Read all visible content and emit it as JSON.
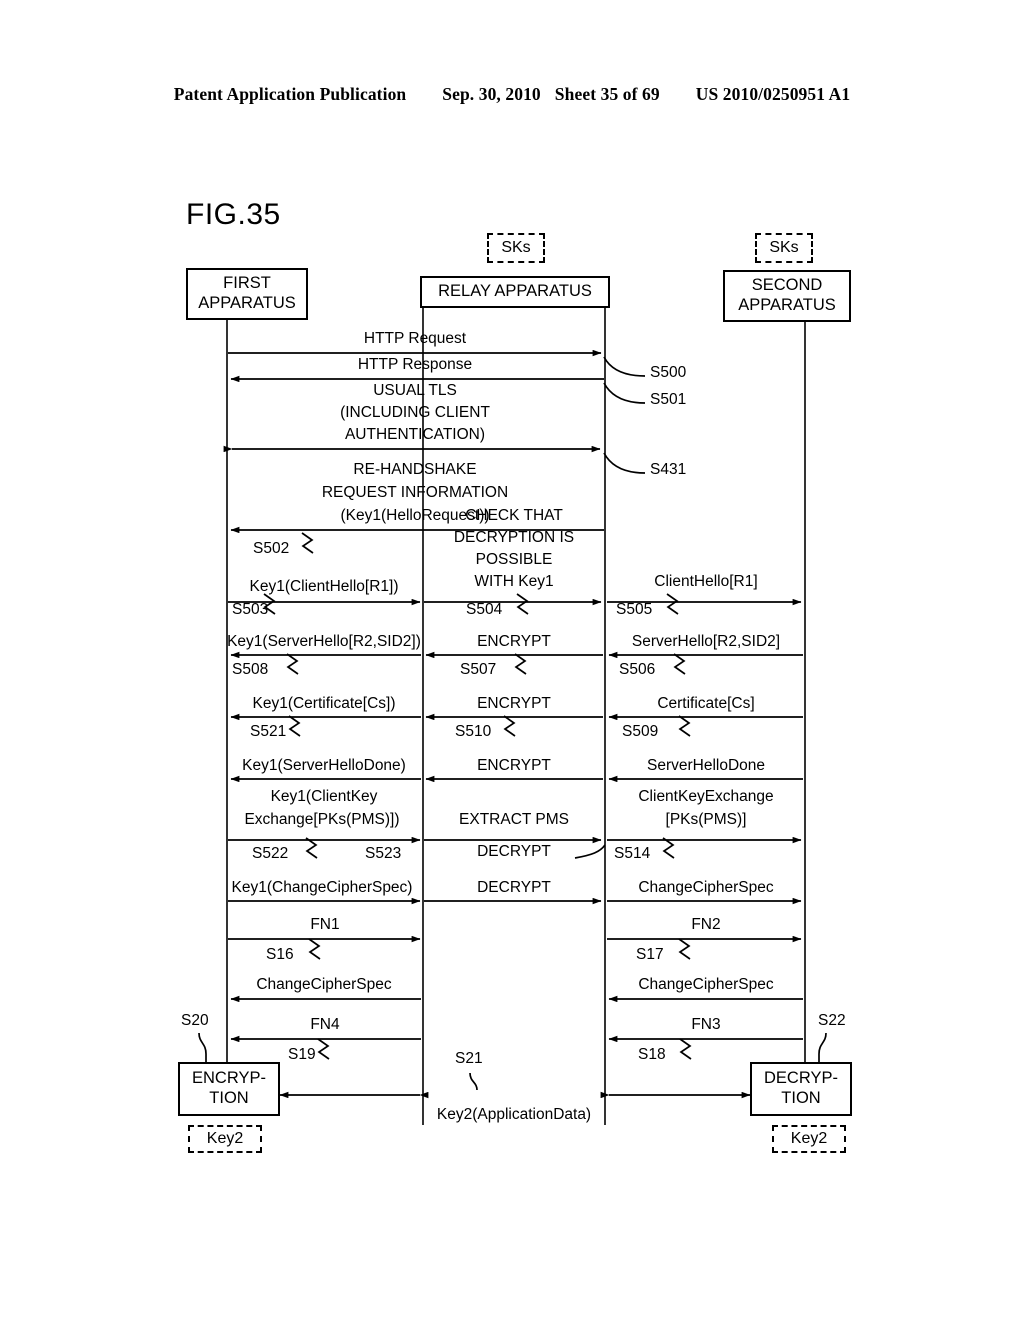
{
  "header": {
    "publication": "Patent Application Publication",
    "date": "Sep. 30, 2010",
    "sheet": "Sheet 35 of 69",
    "patent_number": "US 2010/0250951 A1"
  },
  "figure": {
    "label": "FIG.35",
    "nodes": {
      "first_apparatus": "FIRST\nAPPARATUS",
      "first_apparatus_l1": "FIRST",
      "first_apparatus_l2": "APPARATUS",
      "relay_apparatus": "RELAY APPARATUS",
      "second_apparatus_l1": "SECOND",
      "second_apparatus_l2": "APPARATUS",
      "encryption_l1": "ENCRYP-",
      "encryption_l2": "TION",
      "decryption_l1": "DECRYP-",
      "decryption_l2": "TION"
    },
    "keys": {
      "relay_sks": "SKs",
      "second_sks": "SKs",
      "encryption_key2": "Key2",
      "decryption_key2": "Key2"
    },
    "messages": [
      {
        "id": "m-http-request",
        "text": "HTTP Request"
      },
      {
        "id": "m-http-response",
        "text": "HTTP Response"
      },
      {
        "id": "m-usual-tls-1",
        "text": "USUAL TLS"
      },
      {
        "id": "m-usual-tls-2",
        "text": "(INCLUDING CLIENT"
      },
      {
        "id": "m-usual-tls-3",
        "text": "AUTHENTICATION)"
      },
      {
        "id": "m-rehandshake-1",
        "text": "RE-HANDSHAKE"
      },
      {
        "id": "m-rehandshake-2",
        "text": "REQUEST INFORMATION"
      },
      {
        "id": "m-rehandshake-3",
        "text": "(Key1(HelloRequest))"
      },
      {
        "id": "m-check-1",
        "text": "CHECK THAT"
      },
      {
        "id": "m-check-2",
        "text": "DECRYPTION IS"
      },
      {
        "id": "m-check-3",
        "text": "POSSIBLE"
      },
      {
        "id": "m-check-4",
        "text": "WITH Key1"
      },
      {
        "id": "m-key1-clienthello",
        "text": "Key1(ClientHello[R1])"
      },
      {
        "id": "m-clienthello",
        "text": "ClientHello[R1]"
      },
      {
        "id": "m-key1-serverhello",
        "text": "Key1(ServerHello[R2,SID2])"
      },
      {
        "id": "m-encrypt-1",
        "text": "ENCRYPT"
      },
      {
        "id": "m-serverhello",
        "text": "ServerHello[R2,SID2]"
      },
      {
        "id": "m-key1-certificate",
        "text": "Key1(Certificate[Cs])"
      },
      {
        "id": "m-encrypt-2",
        "text": "ENCRYPT"
      },
      {
        "id": "m-certificate",
        "text": "Certificate[Cs]"
      },
      {
        "id": "m-key1-serverhellodone",
        "text": "Key1(ServerHelloDone)"
      },
      {
        "id": "m-encrypt-3",
        "text": "ENCRYPT"
      },
      {
        "id": "m-serverhellodone",
        "text": "ServerHelloDone"
      },
      {
        "id": "m-key1-clientkey-1",
        "text": "Key1(ClientKey"
      },
      {
        "id": "m-key1-clientkey-2",
        "text": "Exchange[PKs(PMS)])"
      },
      {
        "id": "m-extract-pms",
        "text": "EXTRACT PMS"
      },
      {
        "id": "m-clientkeyexchange-1",
        "text": "ClientKeyExchange"
      },
      {
        "id": "m-clientkeyexchange-2",
        "text": "[PKs(PMS)]"
      },
      {
        "id": "m-decrypt-1",
        "text": "DECRYPT"
      },
      {
        "id": "m-key1-changecipherspec",
        "text": "Key1(ChangeCipherSpec)"
      },
      {
        "id": "m-decrypt-2",
        "text": "DECRYPT"
      },
      {
        "id": "m-changecipherspec-r",
        "text": "ChangeCipherSpec"
      },
      {
        "id": "m-fn1",
        "text": "FN1"
      },
      {
        "id": "m-fn2",
        "text": "FN2"
      },
      {
        "id": "m-changecipherspec-back-l",
        "text": "ChangeCipherSpec"
      },
      {
        "id": "m-changecipherspec-back-r",
        "text": "ChangeCipherSpec"
      },
      {
        "id": "m-fn4",
        "text": "FN4"
      },
      {
        "id": "m-fn3",
        "text": "FN3"
      },
      {
        "id": "m-key2-applicationdata",
        "text": "Key2(ApplicationData)"
      }
    ],
    "steps": [
      {
        "id": "s500",
        "text": "S500"
      },
      {
        "id": "s501",
        "text": "S501"
      },
      {
        "id": "s431",
        "text": "S431"
      },
      {
        "id": "s502",
        "text": "S502"
      },
      {
        "id": "s503",
        "text": "S503"
      },
      {
        "id": "s504",
        "text": "S504"
      },
      {
        "id": "s505",
        "text": "S505"
      },
      {
        "id": "s508",
        "text": "S508"
      },
      {
        "id": "s507",
        "text": "S507"
      },
      {
        "id": "s506",
        "text": "S506"
      },
      {
        "id": "s521",
        "text": "S521"
      },
      {
        "id": "s510",
        "text": "S510"
      },
      {
        "id": "s509",
        "text": "S509"
      },
      {
        "id": "s522",
        "text": "S522"
      },
      {
        "id": "s523",
        "text": "S523"
      },
      {
        "id": "s514",
        "text": "S514"
      },
      {
        "id": "s16",
        "text": "S16"
      },
      {
        "id": "s17",
        "text": "S17"
      },
      {
        "id": "s20",
        "text": "S20"
      },
      {
        "id": "s19",
        "text": "S19"
      },
      {
        "id": "s18",
        "text": "S18"
      },
      {
        "id": "s22",
        "text": "S22"
      },
      {
        "id": "s21",
        "text": "S21"
      }
    ]
  }
}
